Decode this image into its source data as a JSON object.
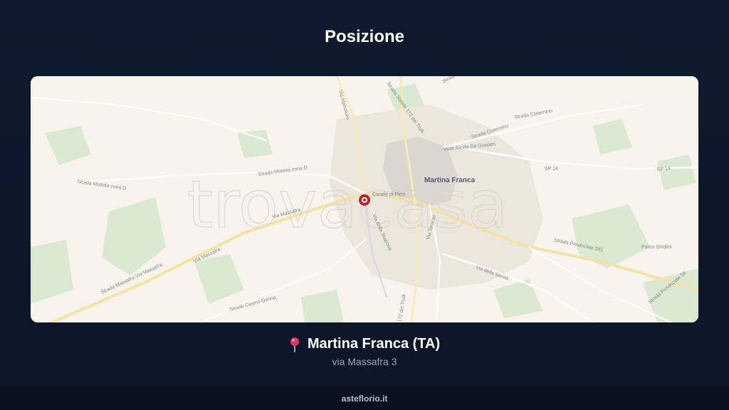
{
  "page": {
    "title": "Posizione"
  },
  "map": {
    "watermark": "trovacasa",
    "city_label": "Martina Franca",
    "street_labels": [
      "Strada Mottola zona D",
      "Strada Mottola zona D",
      "Via Massafra",
      "Via Massafra",
      "Strada Massafra Via Massafra",
      "Strada Statale 172 dei Trulli",
      "Strada Cisternino",
      "Strada Cisternino",
      "Viale Alcide De Gasperi",
      "Via della Stazione",
      "Via Taranto",
      "Via della Sanità",
      "Strada Provinciale 581",
      "Strada Provinciale 58",
      "172 dei Trulli",
      "Strada Casino Genna",
      "SP 14",
      "SP 14",
      "Parco Ortolini",
      "Via Alpinoloro",
      "Strada Orfeo",
      "Canale di Pirro"
    ],
    "pin_color": "#c0242b"
  },
  "location": {
    "name": "Martina Franca (TA)",
    "address": "via Massafra 3"
  },
  "footer": {
    "text": "asteflorio.it"
  }
}
